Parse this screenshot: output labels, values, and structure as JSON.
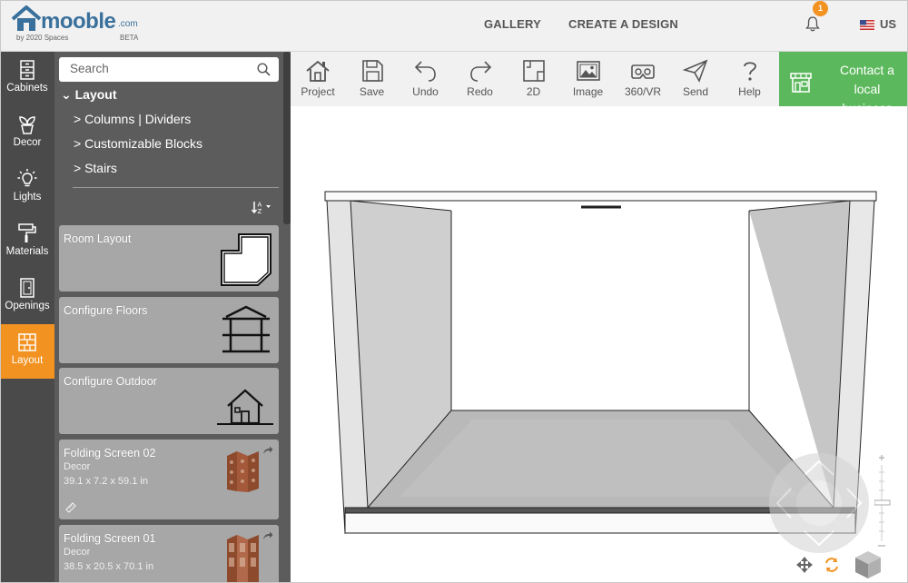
{
  "header": {
    "logo_brand": "mooble",
    "logo_suffix": ".com",
    "logo_by": "by 2020 Spaces",
    "logo_beta": "BETA",
    "nav": [
      "GALLERY",
      "CREATE A DESIGN"
    ],
    "notification_count": "1",
    "locale": "US"
  },
  "rail": {
    "items": [
      {
        "label": "Cabinets",
        "icon": "cabinet-icon"
      },
      {
        "label": "Decor",
        "icon": "plant-icon"
      },
      {
        "label": "Lights",
        "icon": "bulb-icon"
      },
      {
        "label": "Materials",
        "icon": "paint-roller-icon"
      },
      {
        "label": "Openings",
        "icon": "door-icon"
      },
      {
        "label": "Layout",
        "icon": "brick-icon",
        "active": true
      }
    ]
  },
  "panel": {
    "search_placeholder": "Search",
    "tree_root": "Layout",
    "tree_children": [
      "Columns | Dividers",
      "Customizable Blocks",
      "Stairs"
    ],
    "cards": [
      {
        "title": "Room Layout"
      },
      {
        "title": "Configure Floors"
      },
      {
        "title": "Configure Outdoor"
      },
      {
        "title": "Folding Screen 02",
        "category": "Decor",
        "size": "39.1 x 7.2 x 59.1 in"
      },
      {
        "title": "Folding Screen 01",
        "category": "Decor",
        "size": "38.5 x 20.5 x 70.1 in"
      }
    ]
  },
  "toolbar": {
    "tools": [
      "Project",
      "Save",
      "Undo",
      "Redo",
      "2D",
      "Image",
      "360/VR",
      "Send",
      "Help"
    ],
    "contact_label": "Contact a local business"
  },
  "colors": {
    "accent_orange": "#f29221",
    "contact_green": "#5cb85c",
    "brand_blue": "#39709c",
    "rail_bg": "#4a4a4a",
    "panel_bg": "#5c5c5c",
    "card_bg": "#a7a7a7"
  }
}
